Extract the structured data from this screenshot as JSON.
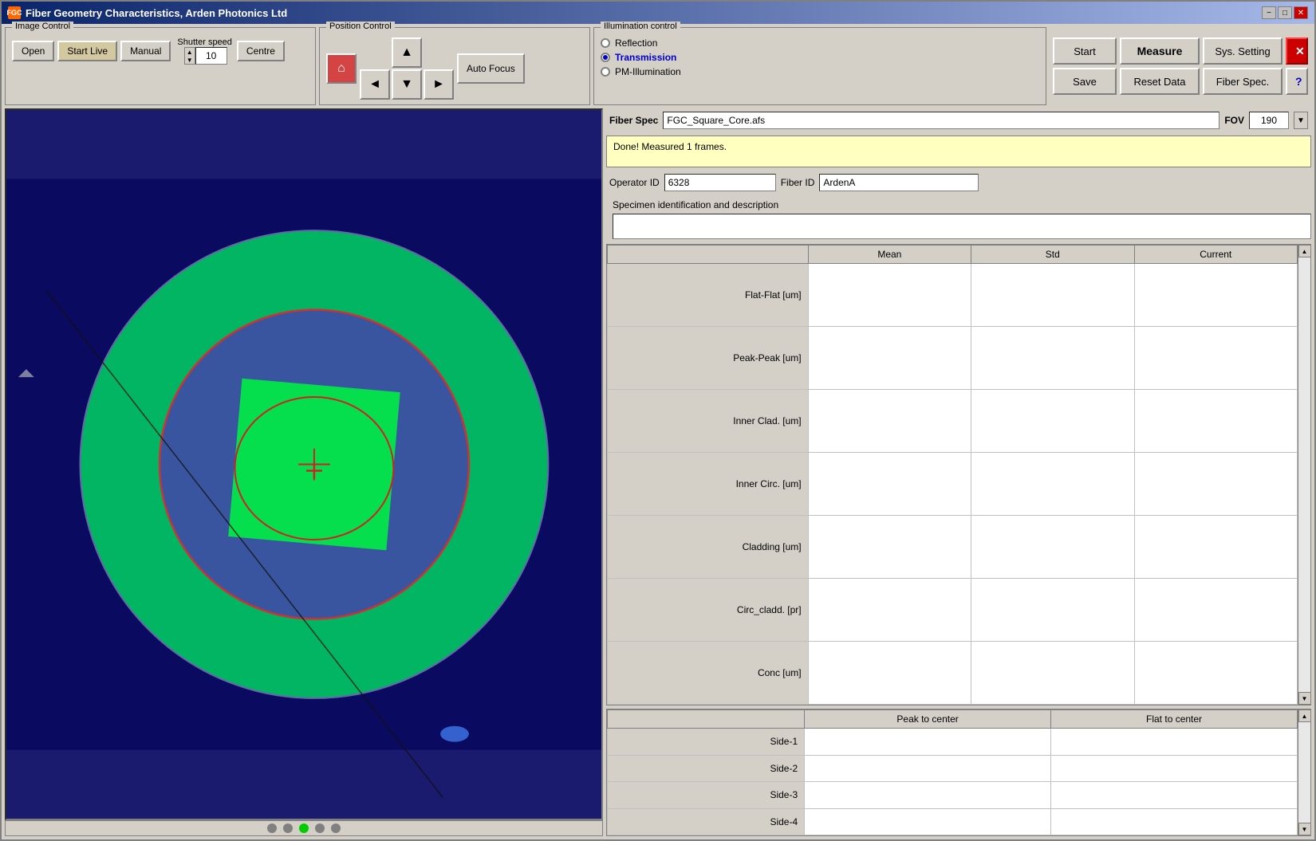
{
  "window": {
    "title": "Fiber Geometry Characteristics, Arden Photonics Ltd",
    "icon": "FGC"
  },
  "imageControl": {
    "groupTitle": "Image Control",
    "openBtn": "Open",
    "startLiveBtn": "Start Live",
    "manualBtn": "Manual",
    "shutterSpeedLabel": "Shutter speed",
    "shutterValue": "10",
    "centreBtn": "Centre"
  },
  "positionControl": {
    "groupTitle": "Position Control",
    "autoFocusBtn": "Auto Focus"
  },
  "illuminationControl": {
    "groupTitle": "Illumination control",
    "options": [
      "Reflection",
      "Transmission",
      "PM-Illumination"
    ],
    "selected": 1
  },
  "topButtons": {
    "startBtn": "Start",
    "measureBtn": "Measure",
    "sysSettingBtn": "Sys. Setting",
    "saveBtn": "Save",
    "resetDataBtn": "Reset Data",
    "fiberSpecBtn": "Fiber Spec."
  },
  "fiberSpec": {
    "label": "Fiber Spec",
    "value": "FGC_Square_Core.afs",
    "fovLabel": "FOV",
    "fovValue": "190"
  },
  "status": {
    "message": "Done! Measured 1 frames."
  },
  "operatorId": {
    "label": "Operator ID",
    "value": "6328",
    "fiberIdLabel": "Fiber ID",
    "fiberIdValue": "ArdenA"
  },
  "specimen": {
    "label": "Specimen identification and description",
    "value": ""
  },
  "dataTable": {
    "columns": [
      "",
      "Mean",
      "Std",
      "Current"
    ],
    "rows": [
      {
        "label": "Flat-Flat  [um]",
        "mean": "",
        "std": "",
        "current": ""
      },
      {
        "label": "Peak-Peak [um]",
        "mean": "",
        "std": "",
        "current": ""
      },
      {
        "label": "Inner Clad.  [um]",
        "mean": "",
        "std": "",
        "current": ""
      },
      {
        "label": "Inner Circ.  [um]",
        "mean": "",
        "std": "",
        "current": ""
      },
      {
        "label": "Cladding     [um]",
        "mean": "",
        "std": "",
        "current": ""
      },
      {
        "label": "Circ_cladd. [pr]",
        "mean": "",
        "std": "",
        "current": ""
      },
      {
        "label": "Conc        [um]",
        "mean": "",
        "std": "",
        "current": ""
      }
    ]
  },
  "bottomTable": {
    "columns": [
      "",
      "Peak to center",
      "Flat to center"
    ],
    "rows": [
      {
        "label": "Side-1",
        "peak": "",
        "flat": ""
      },
      {
        "label": "Side-2",
        "peak": "",
        "flat": ""
      },
      {
        "label": "Side-3",
        "peak": "",
        "flat": ""
      },
      {
        "label": "Side-4",
        "peak": "",
        "flat": ""
      }
    ]
  },
  "bottomDots": [
    "dot1",
    "dot2",
    "dot3-active",
    "dot4",
    "dot5"
  ],
  "titleBarControls": [
    "−",
    "□",
    "✕"
  ],
  "icons": {
    "upArrow": "▲",
    "downArrow": "▼",
    "leftArrow": "◄",
    "rightArrow": "►",
    "upNavArrow": "▲",
    "downNavArrow": "▼",
    "home": "⌂",
    "scrollUp": "▲",
    "scrollDown": "▼"
  }
}
